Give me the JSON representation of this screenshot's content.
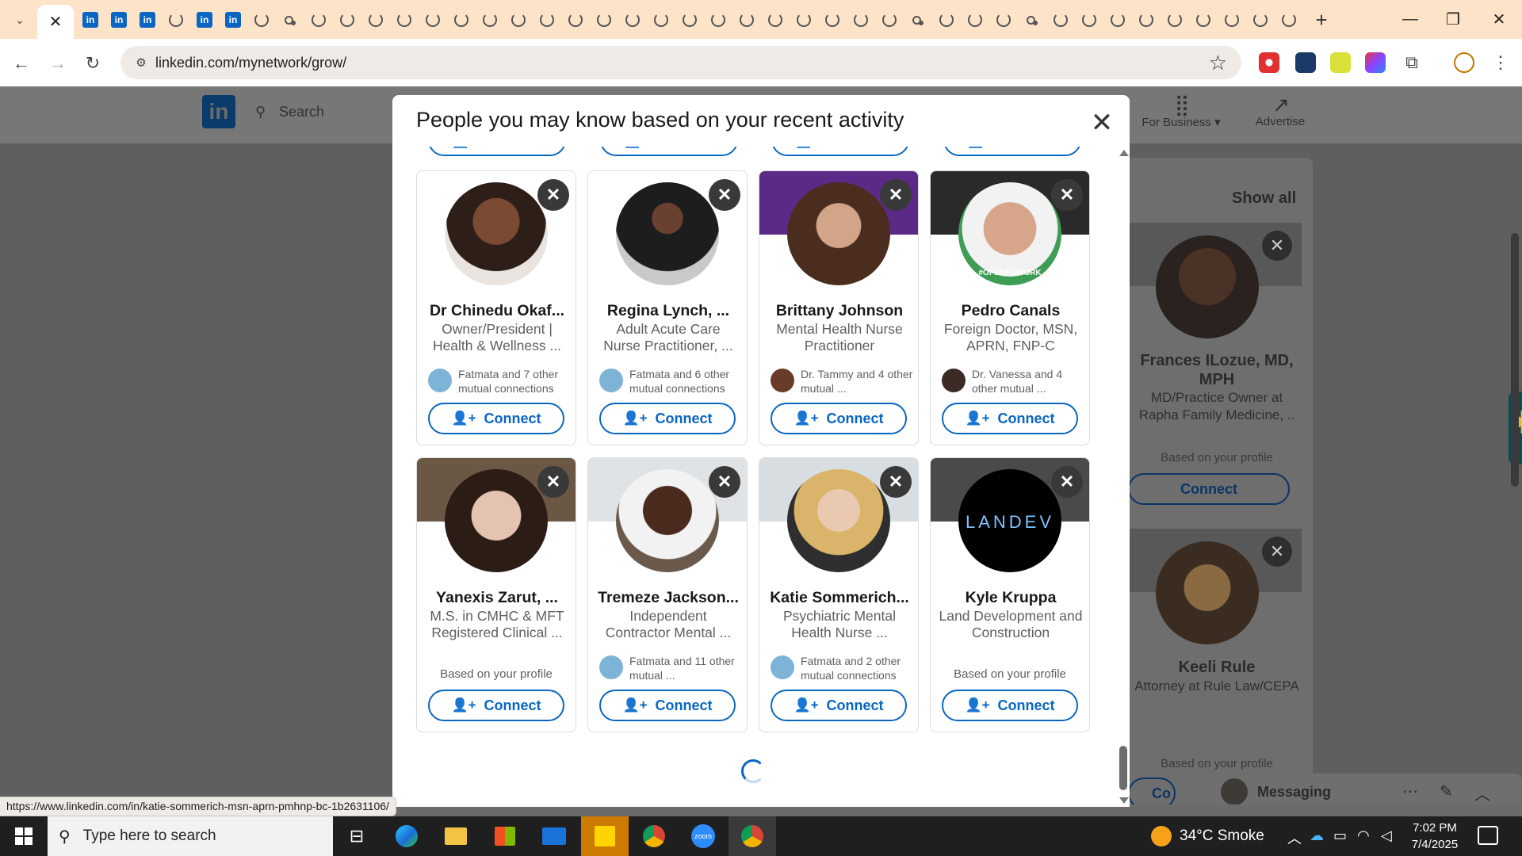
{
  "browser": {
    "url": "linkedin.com/mynetwork/grow/",
    "tab_icons": [
      "linkedin",
      "linkedin",
      "linkedin",
      "loading",
      "linkedin",
      "linkedin",
      "loading",
      "zoom",
      "loading",
      "loading",
      "loading",
      "loading",
      "loading",
      "loading",
      "loading",
      "loading",
      "loading",
      "loading",
      "loading",
      "loading",
      "loading",
      "loading",
      "loading",
      "loading",
      "loading",
      "loading",
      "loading",
      "loading",
      "loading",
      "zoom",
      "loading",
      "loading",
      "loading",
      "zoom",
      "loading",
      "loading",
      "loading",
      "loading",
      "loading",
      "loading",
      "loading",
      "loading",
      "loading"
    ],
    "li_label": "in",
    "new_tab": "+",
    "minimize": "—",
    "restore": "❐",
    "close": "✕",
    "status_url": "https://www.linkedin.com/in/katie-sommerich-msn-aprn-pmhnp-bc-1b2631106/"
  },
  "linkedin": {
    "logo": "in",
    "search_placeholder": "Search",
    "for_business": "For Business ▾",
    "advertise": "Advertise",
    "show_all": "Show all",
    "messaging": "Messaging",
    "right_cards": [
      {
        "name": "Frances ILozue, MD, MPH",
        "headline": "MD/Practice Owner at Rapha Family Medicine, ..",
        "based": "Based on your profile",
        "connect": "Connect"
      },
      {
        "name": "Keeli Rule",
        "headline": "Attorney at Rule Law/CEPA",
        "based": "Based on your profile",
        "connect": "Co"
      }
    ]
  },
  "modal": {
    "title": "People you may know based on your recent activity",
    "close": "✕",
    "connect_label": "Connect",
    "cards": [
      {
        "name": "Dr Chinedu Okaf...",
        "headline": "Owner/President | Health & Wellness ...",
        "mutual": "Fatmata and 7 other mutual connections",
        "based": ""
      },
      {
        "name": "Regina Lynch, ...",
        "headline": "Adult Acute Care Nurse Practitioner, ...",
        "mutual": "Fatmata and 6 other mutual connections",
        "based": ""
      },
      {
        "name": "Brittany Johnson",
        "headline": "Mental Health Nurse Practitioner",
        "mutual": "Dr. Tammy and 4 other mutual ...",
        "based": ""
      },
      {
        "name": "Pedro Canals",
        "headline": "Foreign Doctor, MSN, APRN, FNP-C",
        "mutual": "Dr. Vanessa and 4 other mutual ...",
        "based": ""
      },
      {
        "name": "Yanexis Zarut, ...",
        "headline": "M.S. in CMHC & MFT Registered Clinical ...",
        "mutual": "",
        "based": "Based on your profile"
      },
      {
        "name": "Tremeze Jackson...",
        "headline": "Independent Contractor Mental ...",
        "mutual": "Fatmata and 11 other mutual ...",
        "based": ""
      },
      {
        "name": "Katie Sommerich...",
        "headline": "Psychiatric Mental Health Nurse ...",
        "mutual": "Fatmata and 2 other mutual connections",
        "based": ""
      },
      {
        "name": "Kyle Kruppa",
        "headline": "Land Development and Construction",
        "mutual": "",
        "based": "Based on your profile"
      }
    ],
    "open_to_work": "#OPENTOWORK",
    "landev_logo": "LANDEV"
  },
  "taskbar": {
    "search_placeholder": "Type here to search",
    "weather": "34°C  Smoke",
    "time": "7:02 PM",
    "date": "7/4/2025"
  },
  "colors": {
    "accent": "#0a66c2",
    "tabstrip": "#fde3c7",
    "taskbar": "#1f1f1f"
  }
}
